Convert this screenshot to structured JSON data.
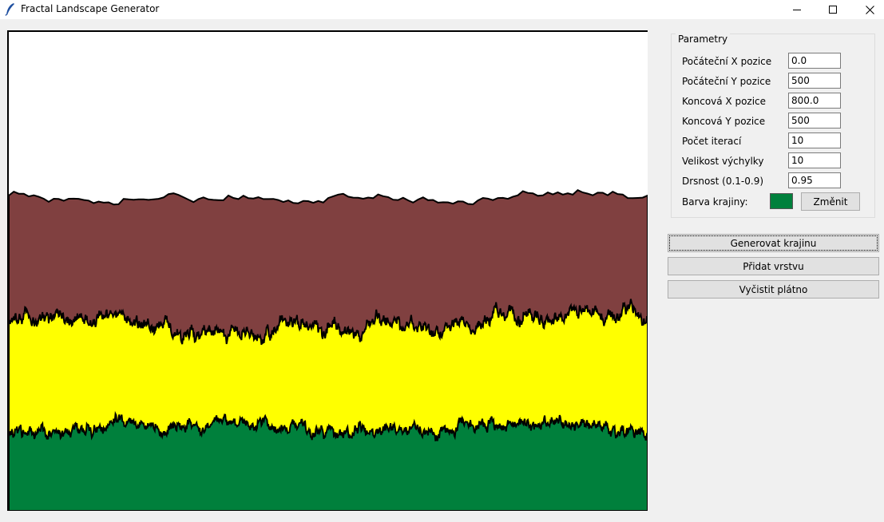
{
  "window": {
    "title": "Fractal Landscape Generator"
  },
  "parameters": {
    "group_label": "Parametry",
    "fields": [
      {
        "label": "Počáteční X pozice",
        "value": "0.0"
      },
      {
        "label": "Počáteční Y pozice",
        "value": "500"
      },
      {
        "label": "Koncová X pozice",
        "value": "800.0"
      },
      {
        "label": "Koncová Y pozice",
        "value": "500"
      },
      {
        "label": "Počet iterací",
        "value": "10"
      },
      {
        "label": "Velikost výchylky",
        "value": "10"
      },
      {
        "label": "Drsnost (0.1-0.9)",
        "value": "0.95"
      }
    ],
    "color_label": "Barva krajiny:",
    "color_value": "#00803c",
    "change_button": "Změnit"
  },
  "actions": {
    "generate": "Generovat krajinu",
    "add_layer": "Přidat vrstvu",
    "clear": "Vyčistit plátno"
  },
  "landscape_layers": [
    {
      "name": "brown-layer",
      "color": "#804040"
    },
    {
      "name": "yellow-layer",
      "color": "#ffff00"
    },
    {
      "name": "green-layer",
      "color": "#00803c"
    }
  ],
  "icons": {
    "app": "feather-icon",
    "minimize": "minimize-icon",
    "maximize": "maximize-icon",
    "close": "close-icon"
  }
}
